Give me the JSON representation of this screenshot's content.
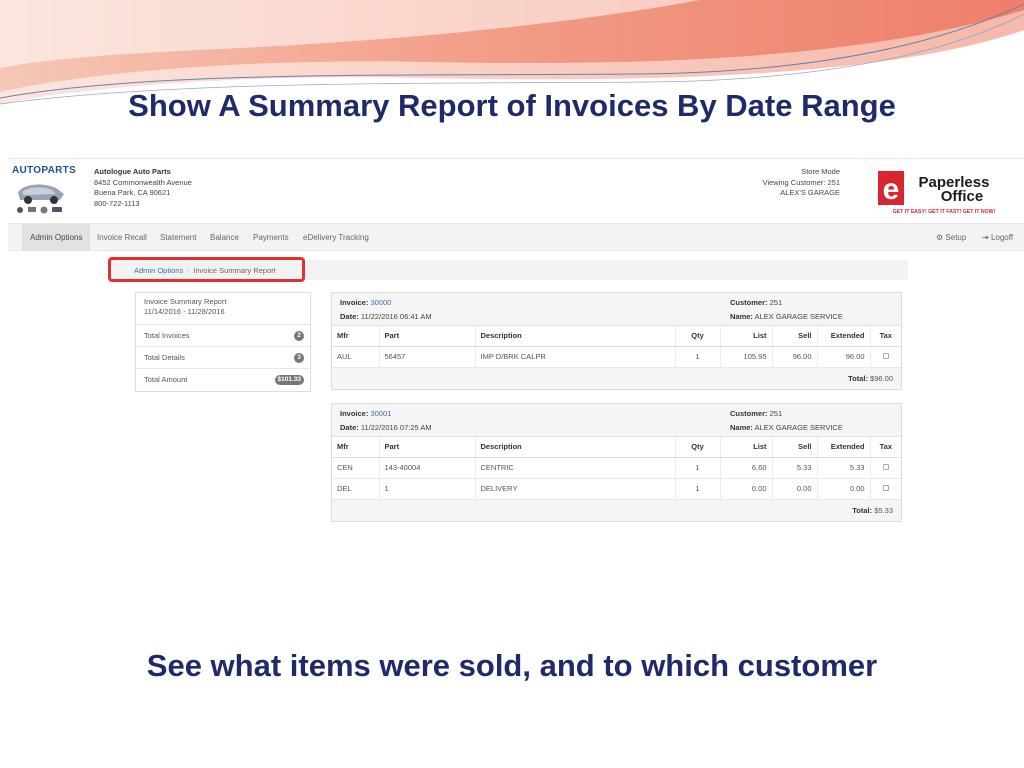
{
  "slide": {
    "title": "Show A Summary Report of Invoices By Date Range",
    "caption": "See what items were sold, and to which customer"
  },
  "app": {
    "logo_text": "AUTOPARTS",
    "store": {
      "name": "Autologue Auto Parts",
      "address1": "8452 Commonwealth Avenue",
      "address2": "Buena Park, CA 90621",
      "phone": "800-722-1113"
    },
    "view": {
      "mode": "Store Mode",
      "viewing": "Viewing Customer: 251",
      "customer": "ALEX'S GARAGE"
    },
    "brand_logo": {
      "letter": "e",
      "line1": "Paperless",
      "line2": "Office",
      "tagline": "GET IT EASY! GET IT FAST! GET IT NOW!"
    },
    "nav": {
      "items": [
        "Admin Options",
        "Invoice Recall",
        "Statement",
        "Balance",
        "Payments",
        "eDelivery Tracking"
      ],
      "setup": "Setup",
      "logoff": "Logoff"
    },
    "breadcrumb": {
      "parent": "Admin Options",
      "separator": "/",
      "current": "Invoice Summary Report"
    },
    "summary": {
      "title": "Invoice Summary Report",
      "range": "11/14/2016 - 11/28/2016",
      "rows": [
        {
          "label": "Total Invoices",
          "value": "2"
        },
        {
          "label": "Total Details",
          "value": "3"
        },
        {
          "label": "Total Amount",
          "value": "$101.33"
        }
      ]
    },
    "columns": [
      "Mfr",
      "Part",
      "Description",
      "Qty",
      "List",
      "Sell",
      "Extended",
      "Tax"
    ],
    "invoices": [
      {
        "invoice_label": "Invoice:",
        "invoice_no": "30000",
        "date_label": "Date:",
        "date": "11/22/2016 06:41 AM",
        "customer_label": "Customer:",
        "customer": "251",
        "name_label": "Name:",
        "name": "ALEX GARAGE SERVICE",
        "lines": [
          {
            "mfr": "AUL",
            "part": "56457",
            "description": "IMP D/BRK CALPR",
            "qty": "1",
            "list": "105.95",
            "sell": "96.00",
            "extended": "96.00"
          }
        ],
        "total_label": "Total:",
        "total": "$96.00"
      },
      {
        "invoice_label": "Invoice:",
        "invoice_no": "30001",
        "date_label": "Date:",
        "date": "11/22/2016 07:25 AM",
        "customer_label": "Customer:",
        "customer": "251",
        "name_label": "Name:",
        "name": "ALEX GARAGE SERVICE",
        "lines": [
          {
            "mfr": "CEN",
            "part": "143-40004",
            "description": "CENTRIC",
            "qty": "1",
            "list": "6.60",
            "sell": "5.33",
            "extended": "5.33"
          },
          {
            "mfr": "DEL",
            "part": "1",
            "description": "DELIVERY",
            "qty": "1",
            "list": "0.00",
            "sell": "0.00",
            "extended": "0.00"
          }
        ],
        "total_label": "Total:",
        "total": "$5.33"
      }
    ],
    "colors": {
      "title": "#1f2a6b",
      "link": "#3a6ea8",
      "highlight": "#e03030",
      "swoosh": "#f0a08a"
    }
  }
}
